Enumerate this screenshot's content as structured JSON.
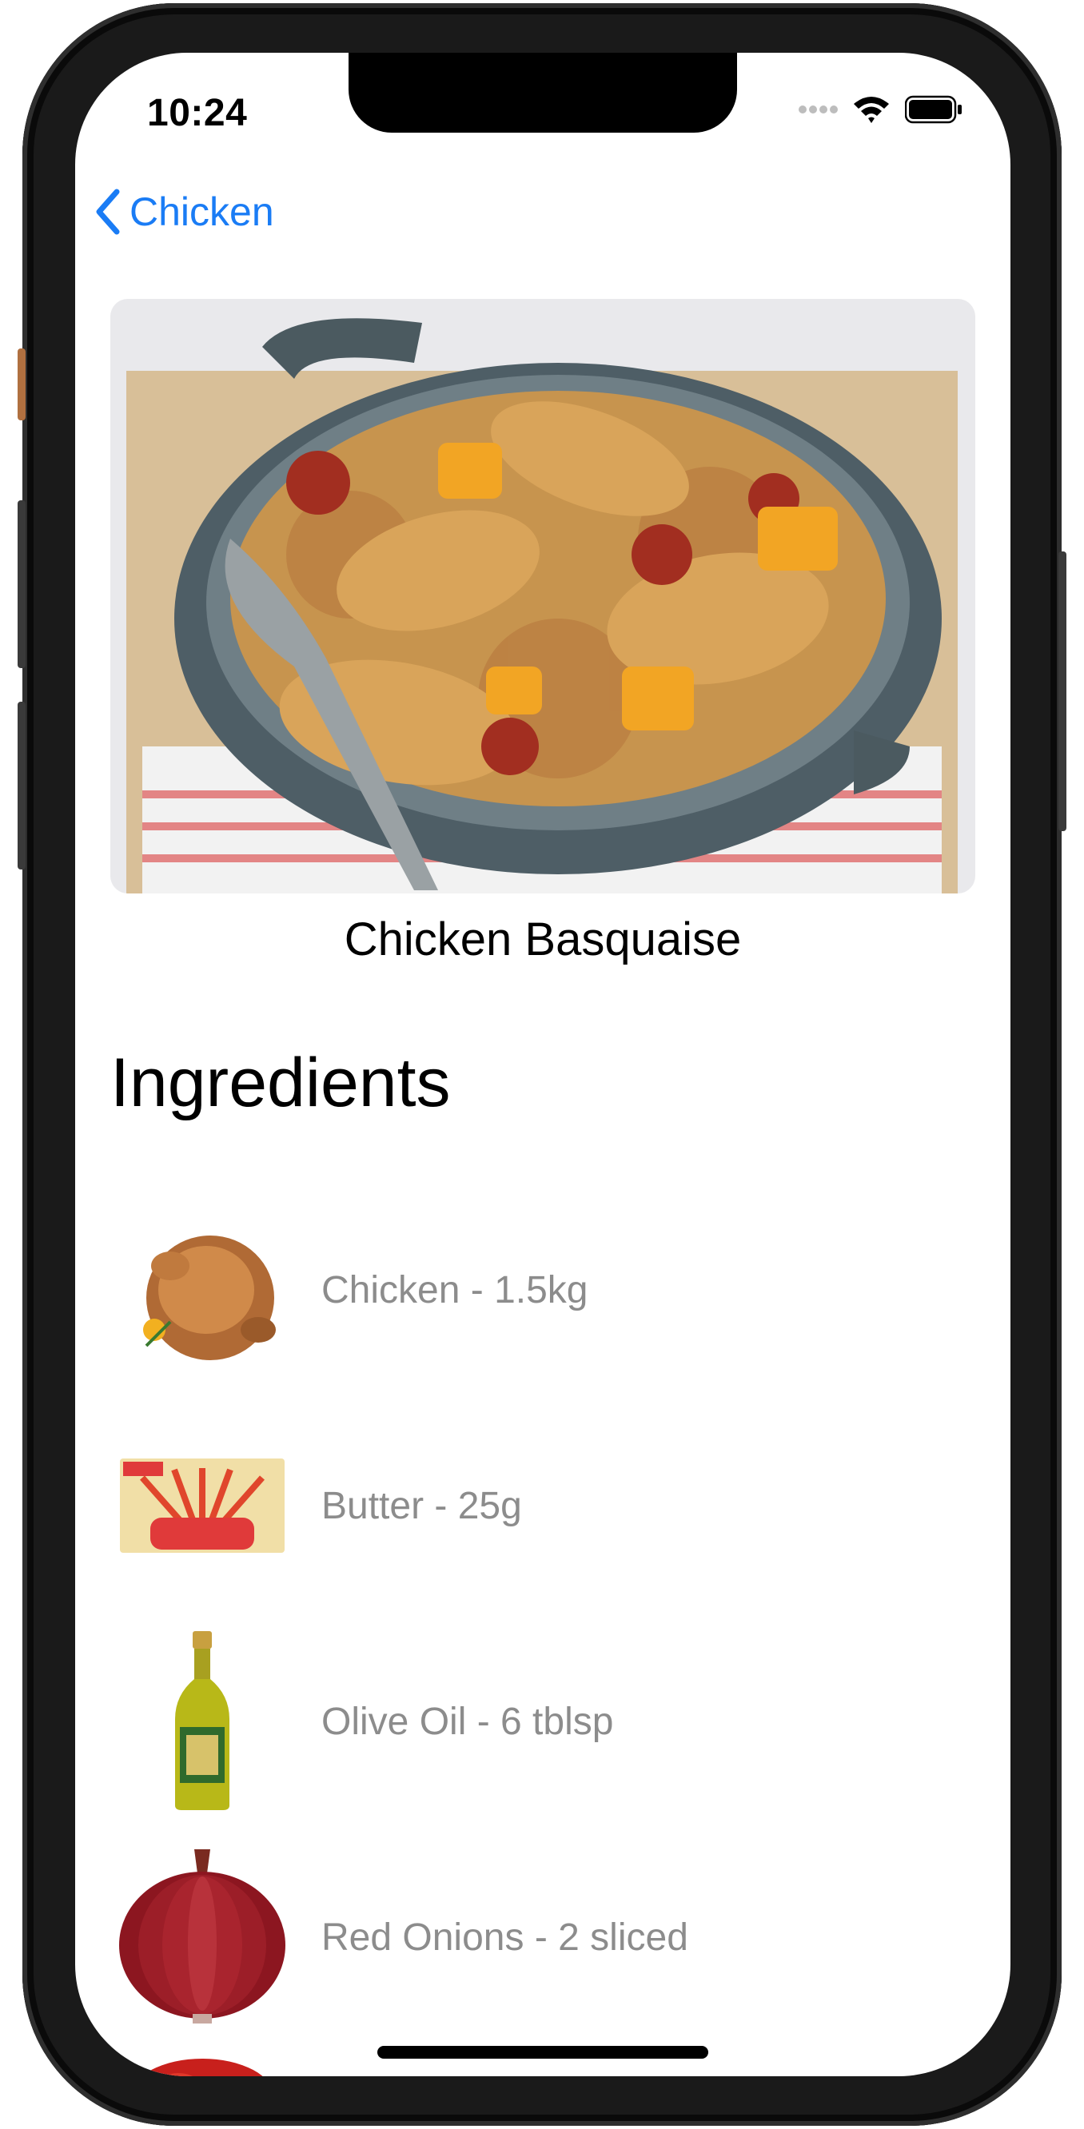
{
  "status_bar": {
    "time": "10:24"
  },
  "nav": {
    "back_label": "Chicken"
  },
  "recipe": {
    "title": "Chicken Basquaise"
  },
  "ingredients_section": {
    "heading": "Ingredients",
    "items": [
      {
        "label": "Chicken - 1.5kg",
        "icon": "roast-chicken-image"
      },
      {
        "label": "Butter - 25g",
        "icon": "butter-image"
      },
      {
        "label": "Olive Oil - 6 tblsp",
        "icon": "olive-oil-image"
      },
      {
        "label": "Red Onions - 2 sliced",
        "icon": "red-onion-image"
      }
    ]
  },
  "colors": {
    "accent": "#1a7cf5",
    "ingredient_text": "#8c8c8c",
    "background": "#ffffff"
  }
}
